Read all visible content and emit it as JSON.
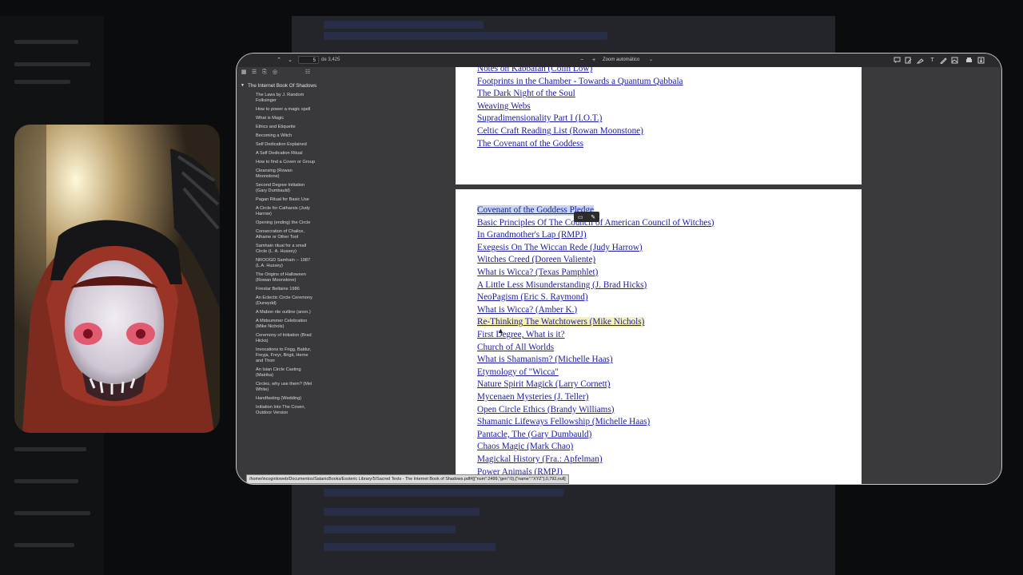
{
  "toolbar": {
    "page_number": "5",
    "page_count": "de 3,425",
    "zoom": "Zoom automático",
    "zoom_out": "−",
    "zoom_in": "+",
    "prev": "⌃",
    "next": "⌄"
  },
  "sidebar": {
    "root": "The Internet Book Of Shadows",
    "items": [
      "The Laws by J. Random Folksinger",
      "How to power a magic spell",
      "What is Magic",
      "Ethics and Etiquette",
      "Becoming a Witch",
      "Self Dedication Explained",
      "A Self Dedication Ritual",
      "How to find a Coven or Group",
      "Cleansing (Rowan Moonstone)",
      "Second Degree Initiation (Gary Dumbauld)",
      "Pagan Ritual for Basic Use",
      "A Circle for Catharsis (Judy Harrow)",
      "Opening (ending) the Circle",
      "Consecration of Chalice, Athame or Other Tool",
      "Samhain ritual for a small Circle (L. A. Hussey)",
      "NROOGD Samhain -- 1987 (L.A. Hussey)",
      "The Origins of Halloween (Rowan Moonstone)",
      "Firestar Beltaine 1986",
      "An Eclectic Circle Ceremony (Durwydd)",
      "A Mabon rite outline (anon.)",
      "A Midsummer Celebration (Mike Nichols)",
      "Ceremony of Initiation (Brad Hicks)",
      "Invocations to Frigg, Baldur, Freyja, Freyr, Brigit, Herne and Thorr",
      "An Isian Circle Casting (Matrika)",
      "Circles, why use them? (Mel White)",
      "Handfasting (Wedding)",
      "Initiation Into The Coven, Outdoor Version"
    ]
  },
  "page1_links": [
    "Notes on Kabbalah (Colin Low)",
    "Footprints in the Chamber - Towards a Quantum Qabbala",
    "The Dark Night of the Soul",
    "Weaving Webs",
    "Supradimensionality Part I (I.O.T.)",
    "Celtic Craft Reading List (Rowan Moonstone)",
    "The Covenant of the Goddess"
  ],
  "page2_links": [
    "Covenant of the Goddess Pledge",
    "Basic Principles Of The Council of American Council of Witches)",
    "In Grandmother's Lap (RMPJ)",
    "Exegesis On The Wiccan Rede (Judy Harrow)",
    "Witches Creed (Doreen Valiente)",
    "What is Wicca? (Texas Pamphlet)",
    "A Little Less Misunderstanding (J. Brad Hicks)",
    "NeoPagism (Eric S. Raymond)",
    "What is Wicca? (Amber K.)",
    "Re-Thinking The Watchtowers (Mike Nichols)",
    "First Degree, What is it?",
    "Church of All Worlds",
    "What is Shamanism? (Michelle Haas)",
    "Etymology of \"Wicca\"",
    "Nature Spirit Magick (Larry Cornett)",
    "Mycenaen Mysteries (J. Teller)",
    "Open Circle Ethics (Brandy Williams)",
    "Shamanic Lifeways Fellowship (Michelle Haas)",
    "Pantacle, The (Gary Dumbauld)",
    "Chaos Magic (Mark Chao)",
    "Magickal History (Fra.: Apfelman)",
    "Power Animals (RMPJ)"
  ],
  "status_url": "/home/incognitoweb/Documentos/SatanicBooks/Esoteric Library/5/Sacred Texts - The Internet Book of Shadows.pdf#[{\"num\":2499,\"gen\":0},{\"name\":\"XYZ\"},0,792,null]",
  "colors": {
    "link": "#1a1aa6",
    "selection": "#c9d6ef",
    "hover_highlight": "#f6f1b6"
  }
}
